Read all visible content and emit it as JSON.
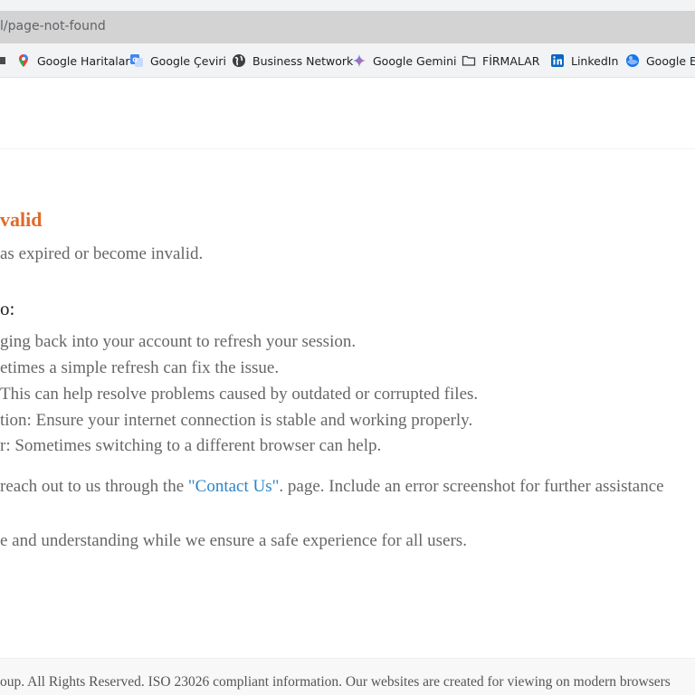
{
  "browser": {
    "address_text": "l/page-not-found",
    "bookmarks": [
      {
        "label": "",
        "icon": "truncated-icon"
      },
      {
        "label": "Google Haritalar",
        "icon": "maps-pin-icon"
      },
      {
        "label": "Google Çeviri",
        "icon": "translate-icon"
      },
      {
        "label": "Business Network",
        "icon": "globe-icon"
      },
      {
        "label": "Google Gemini",
        "icon": "gemini-sparkle-icon"
      },
      {
        "label": "FİRMALAR",
        "icon": "folder-icon"
      },
      {
        "label": "LinkedIn",
        "icon": "linkedin-icon"
      },
      {
        "label": "Google Ea",
        "icon": "google-earth-icon"
      }
    ]
  },
  "main": {
    "title": "valid",
    "intro": "as expired or become invalid.",
    "subheading": "o:",
    "tips": [
      "ging back into your account to refresh your session.",
      "etimes a simple refresh can fix the issue.",
      "This can help resolve problems caused by outdated or corrupted files.",
      "tion: Ensure your internet connection is stable and working properly.",
      "r: Sometimes switching to a different browser can help."
    ],
    "contact_before": "reach out to us through the ",
    "contact_link": "\"Contact Us\"",
    "contact_after": ". page. Include an error screenshot for further assistance",
    "closing": "e and understanding while we ensure a safe experience for all users."
  },
  "footer": {
    "text": "oup. All Rights Reserved. ISO 23026 compliant information. Our websites are created for viewing on modern browsers"
  },
  "colors": {
    "title_accent": "#e06a2a",
    "link": "#2a86c8",
    "body_text": "#666666"
  }
}
